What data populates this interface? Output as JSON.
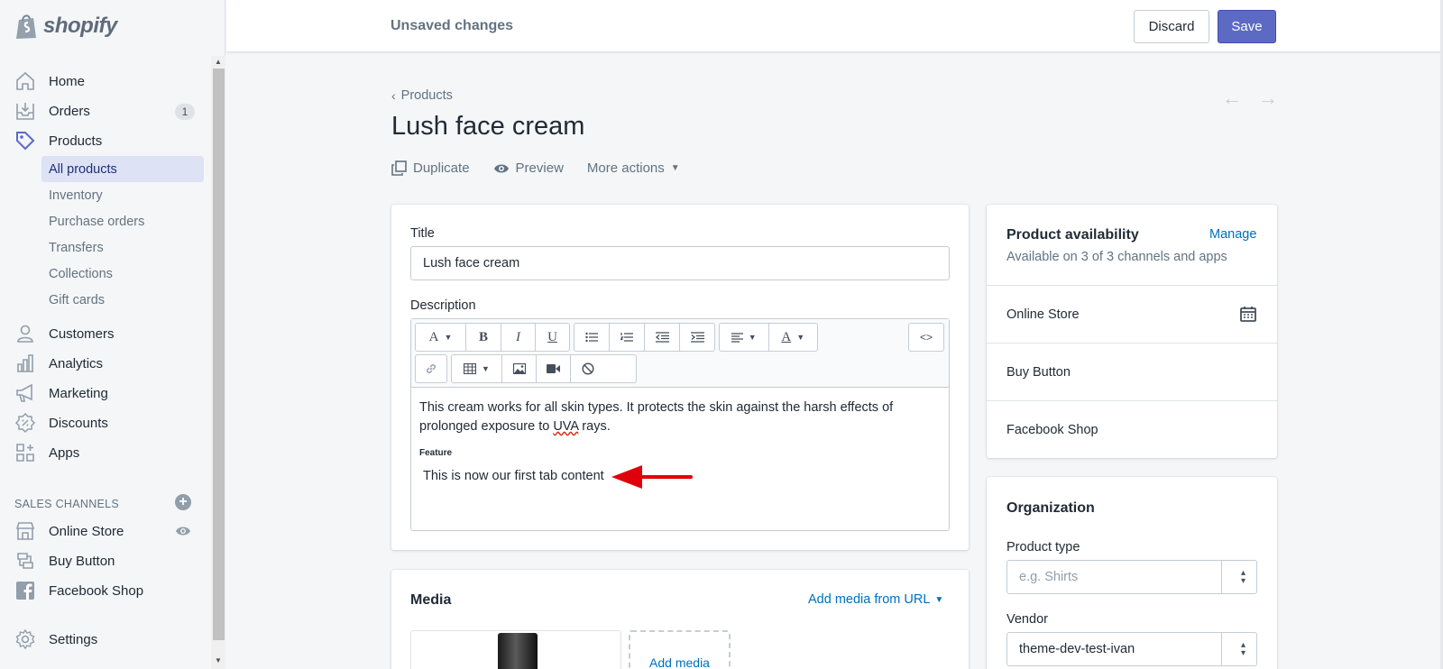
{
  "brand": {
    "name": "shopify"
  },
  "sidebar": {
    "items": [
      {
        "label": "Home",
        "icon": "home-icon"
      },
      {
        "label": "Orders",
        "icon": "orders-icon",
        "badge": "1"
      },
      {
        "label": "Products",
        "icon": "tag-icon"
      },
      {
        "label": "Customers",
        "icon": "person-icon"
      },
      {
        "label": "Analytics",
        "icon": "bar-chart-icon"
      },
      {
        "label": "Marketing",
        "icon": "megaphone-icon"
      },
      {
        "label": "Discounts",
        "icon": "discount-icon"
      },
      {
        "label": "Apps",
        "icon": "apps-icon"
      }
    ],
    "product_subitems": [
      "All products",
      "Inventory",
      "Purchase orders",
      "Transfers",
      "Collections",
      "Gift cards"
    ],
    "sales_channels_heading": "SALES CHANNELS",
    "channels": [
      {
        "label": "Online Store",
        "icon": "store-icon"
      },
      {
        "label": "Buy Button",
        "icon": "buy-button-icon"
      },
      {
        "label": "Facebook Shop",
        "icon": "facebook-icon"
      }
    ],
    "settings_label": "Settings"
  },
  "topbar": {
    "status": "Unsaved changes",
    "discard_label": "Discard",
    "save_label": "Save"
  },
  "page": {
    "breadcrumb": "Products",
    "title": "Lush face cream",
    "actions": {
      "duplicate": "Duplicate",
      "preview": "Preview",
      "more": "More actions"
    }
  },
  "product_form": {
    "title_label": "Title",
    "title_value": "Lush face cream",
    "description_label": "Description",
    "description_text_before": "This cream works for all skin types. It protects the skin against the harsh effects of prolonged exposure to ",
    "description_text_misspelled": "UVA",
    "description_text_after": " rays.",
    "feature_heading": "Feature",
    "tab_content": "This is now our first tab content",
    "html_toggle": "<>"
  },
  "media": {
    "title": "Media",
    "add_from_url": "Add media from URL",
    "add_media": "Add media"
  },
  "availability": {
    "title": "Product availability",
    "manage": "Manage",
    "subtitle": "Available on 3 of 3 channels and apps",
    "channels": [
      "Online Store",
      "Buy Button",
      "Facebook Shop"
    ]
  },
  "organization": {
    "title": "Organization",
    "product_type_label": "Product type",
    "product_type_placeholder": "e.g. Shirts",
    "vendor_label": "Vendor",
    "vendor_value": "theme-dev-test-ivan"
  },
  "colors": {
    "accent": "#5c6ac4",
    "annotation_arrow": "#e0000b",
    "link": "#006fbb"
  }
}
